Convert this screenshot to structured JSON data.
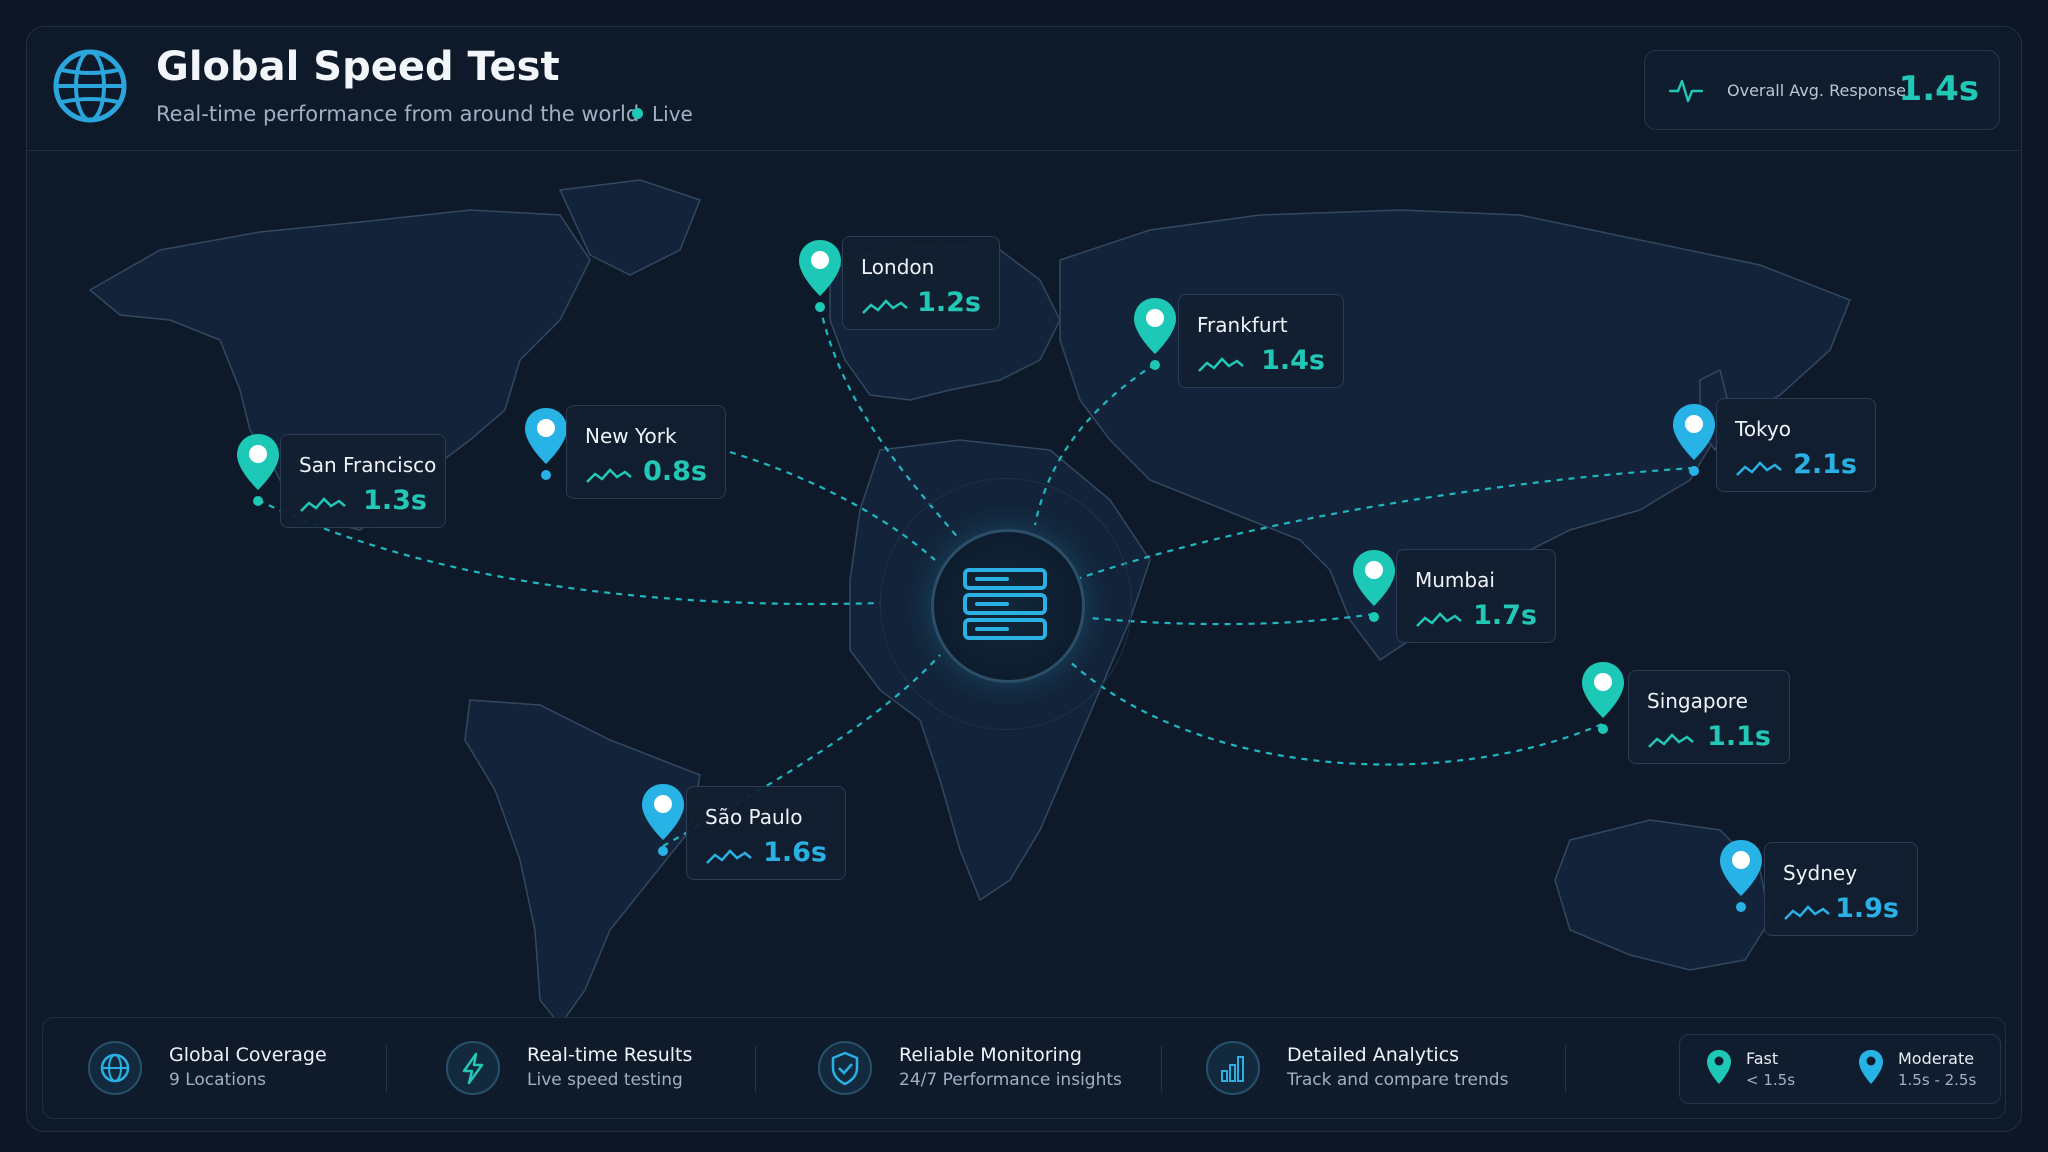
{
  "header": {
    "title": "Global Speed Test",
    "subtitle": "Real-time performance from around the world",
    "live_label": "Live",
    "avg_label": "Overall Avg. Response",
    "avg_value": "1.4s"
  },
  "colors": {
    "fast": "#1ec8b6",
    "moderate": "#27b3e6",
    "background": "#0c1624"
  },
  "locations": [
    {
      "city": "London",
      "value": "1.2s",
      "speed": "fast"
    },
    {
      "city": "Frankfurt",
      "value": "1.4s",
      "speed": "fast"
    },
    {
      "city": "San Francisco",
      "value": "1.3s",
      "speed": "fast"
    },
    {
      "city": "New York",
      "value": "0.8s",
      "speed": "fast"
    },
    {
      "city": "Tokyo",
      "value": "2.1s",
      "speed": "moderate"
    },
    {
      "city": "Mumbai",
      "value": "1.7s",
      "speed": "moderate"
    },
    {
      "city": "Singapore",
      "value": "1.1s",
      "speed": "fast"
    },
    {
      "city": "São Paulo",
      "value": "1.6s",
      "speed": "moderate"
    },
    {
      "city": "Sydney",
      "value": "1.9s",
      "speed": "moderate"
    }
  ],
  "features": [
    {
      "title": "Global Coverage",
      "subtitle": "9 Locations",
      "icon": "globe-icon"
    },
    {
      "title": "Real-time Results",
      "subtitle": "Live speed testing",
      "icon": "lightning-icon"
    },
    {
      "title": "Reliable Monitoring",
      "subtitle": "24/7 Performance insights",
      "icon": "shield-check-icon"
    },
    {
      "title": "Detailed Analytics",
      "subtitle": "Track and compare trends",
      "icon": "bar-chart-icon"
    }
  ],
  "legend": [
    {
      "label": "Fast",
      "range": "< 1.5s"
    },
    {
      "label": "Moderate",
      "range": "1.5s - 2.5s"
    }
  ]
}
